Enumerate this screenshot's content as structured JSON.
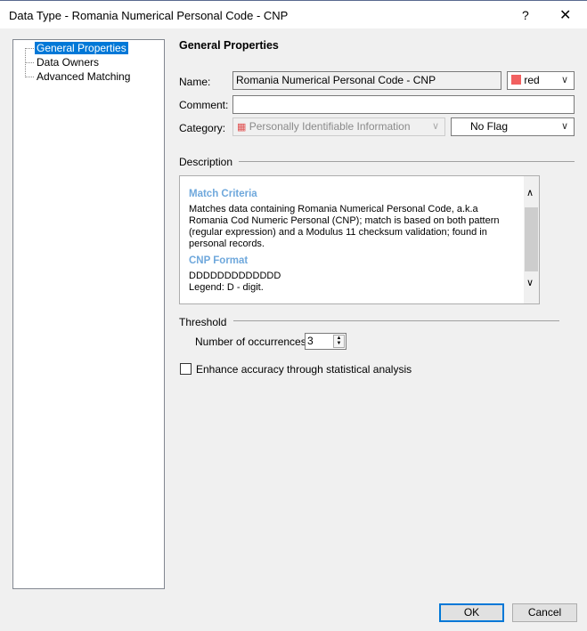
{
  "window": {
    "title": "Data Type - Romania Numerical Personal Code - CNP",
    "help": "?",
    "close": "✕"
  },
  "tree": [
    "General Properties",
    "Data Owners",
    "Advanced Matching"
  ],
  "panel": {
    "heading": "General Properties",
    "name_label": "Name:",
    "name_value": "Romania Numerical Personal Code - CNP",
    "color_value": "red",
    "color_swatch": "#f26060",
    "comment_label": "Comment:",
    "comment_value": "",
    "category_label": "Category:",
    "category_value": "Personally Identifiable Information",
    "flag_value": "No Flag",
    "description_label": "Description",
    "description": {
      "h1": "Match Criteria",
      "p1": "Matches data containing Romania Numerical Personal Code, a.k.a Romania Cod Numeric Personal (CNP); match is based on both pattern (regular expression) and a Modulus 11 checksum validation; found in personal records.",
      "h2": "CNP Format",
      "p2": "DDDDDDDDDDDDD",
      "p3": "Legend: D - digit."
    },
    "threshold_label": "Threshold",
    "occurrences_label": "Number of occurrences:",
    "occurrences_value": "3",
    "enhance_label": "Enhance accuracy through statistical analysis",
    "enhance_checked": false
  },
  "buttons": {
    "ok": "OK",
    "cancel": "Cancel"
  }
}
